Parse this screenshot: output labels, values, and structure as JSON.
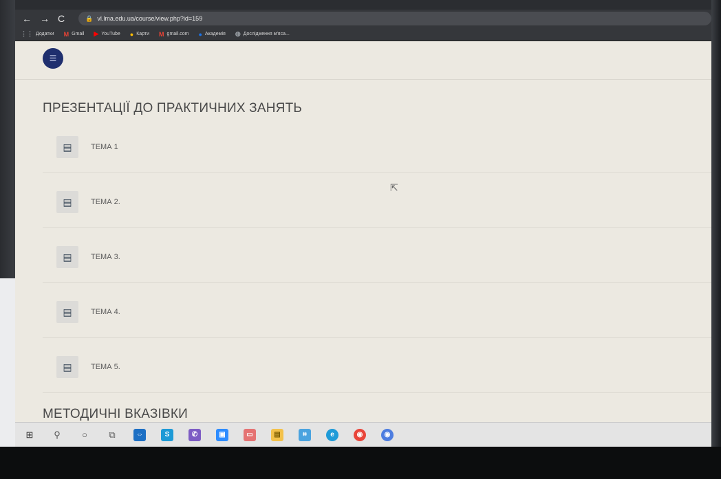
{
  "browser": {
    "url": "vl.lma.edu.ua/course/view.php?id=159",
    "nav": {
      "back": "←",
      "forward": "→",
      "reload": "C"
    },
    "bookmarks": [
      {
        "icon": "apps-icon",
        "glyph": "⋮⋮",
        "label": "Додатки",
        "color": "#9aa0a6"
      },
      {
        "icon": "gmail-icon",
        "glyph": "M",
        "label": "Gmail",
        "color": "#ea4335"
      },
      {
        "icon": "youtube-icon",
        "glyph": "▶",
        "label": "YouTube",
        "color": "#ff0000"
      },
      {
        "icon": "maps-icon",
        "glyph": "●",
        "label": "Карти",
        "color": "#fbbc04"
      },
      {
        "icon": "gmail-icon",
        "glyph": "M",
        "label": "gmail.com",
        "color": "#ea4335"
      },
      {
        "icon": "academy-icon",
        "glyph": "●",
        "label": "Академія",
        "color": "#1a73e8"
      },
      {
        "icon": "globe-icon",
        "glyph": "◍",
        "label": "Дослідження м'яса...",
        "color": "#9aa0a6"
      }
    ]
  },
  "page": {
    "section1_title": "ПРЕЗЕНТАЦІЇ ДО ПРАКТИЧНИХ ЗАНЯТЬ",
    "items": [
      {
        "label": "ТЕМА 1"
      },
      {
        "label": "ТЕМА 2."
      },
      {
        "label": "ТЕМА 3."
      },
      {
        "label": "ТЕМА 4."
      },
      {
        "label": "ТЕМА 5."
      }
    ],
    "section2_title": "МЕТОДИЧНІ ВКАЗІВКИ"
  },
  "taskbar": [
    {
      "name": "start-icon",
      "glyph": "⊞",
      "bg": "",
      "color": "#333"
    },
    {
      "name": "search-icon",
      "glyph": "⚲",
      "bg": "",
      "color": "#555"
    },
    {
      "name": "cortana-icon",
      "glyph": "○",
      "bg": "",
      "color": "#444"
    },
    {
      "name": "task-view-icon",
      "glyph": "⧉",
      "bg": "",
      "color": "#555"
    },
    {
      "name": "teamviewer-icon",
      "glyph": "⇔",
      "bg": "#1c6fc4",
      "color": "#fff"
    },
    {
      "name": "skype-icon",
      "glyph": "S",
      "bg": "#1d9ad6",
      "color": "#fff"
    },
    {
      "name": "viber-icon",
      "glyph": "✆",
      "bg": "#7d5cc4",
      "color": "#fff"
    },
    {
      "name": "zoom-icon",
      "glyph": "▣",
      "bg": "#2d8cff",
      "color": "#fff"
    },
    {
      "name": "media-icon",
      "glyph": "▭",
      "bg": "#e57373",
      "color": "#fff"
    },
    {
      "name": "file-explorer-icon",
      "glyph": "▤",
      "bg": "#f3c14a",
      "color": "#7a5a00"
    },
    {
      "name": "app-icon",
      "glyph": "⌗",
      "bg": "#4aa3df",
      "color": "#fff"
    },
    {
      "name": "edge-icon",
      "glyph": "e",
      "bg": "#1f9bd8",
      "color": "#fff"
    },
    {
      "name": "chrome-icon",
      "glyph": "◉",
      "bg": "#e9453a",
      "color": "#fff"
    },
    {
      "name": "chrome-alt-icon",
      "glyph": "◉",
      "bg": "#4d7de0",
      "color": "#fff"
    }
  ],
  "colors": {
    "page_bg": "#ece9e1",
    "drawer_button": "#1f2f6e",
    "text": "#4a4a4a"
  }
}
